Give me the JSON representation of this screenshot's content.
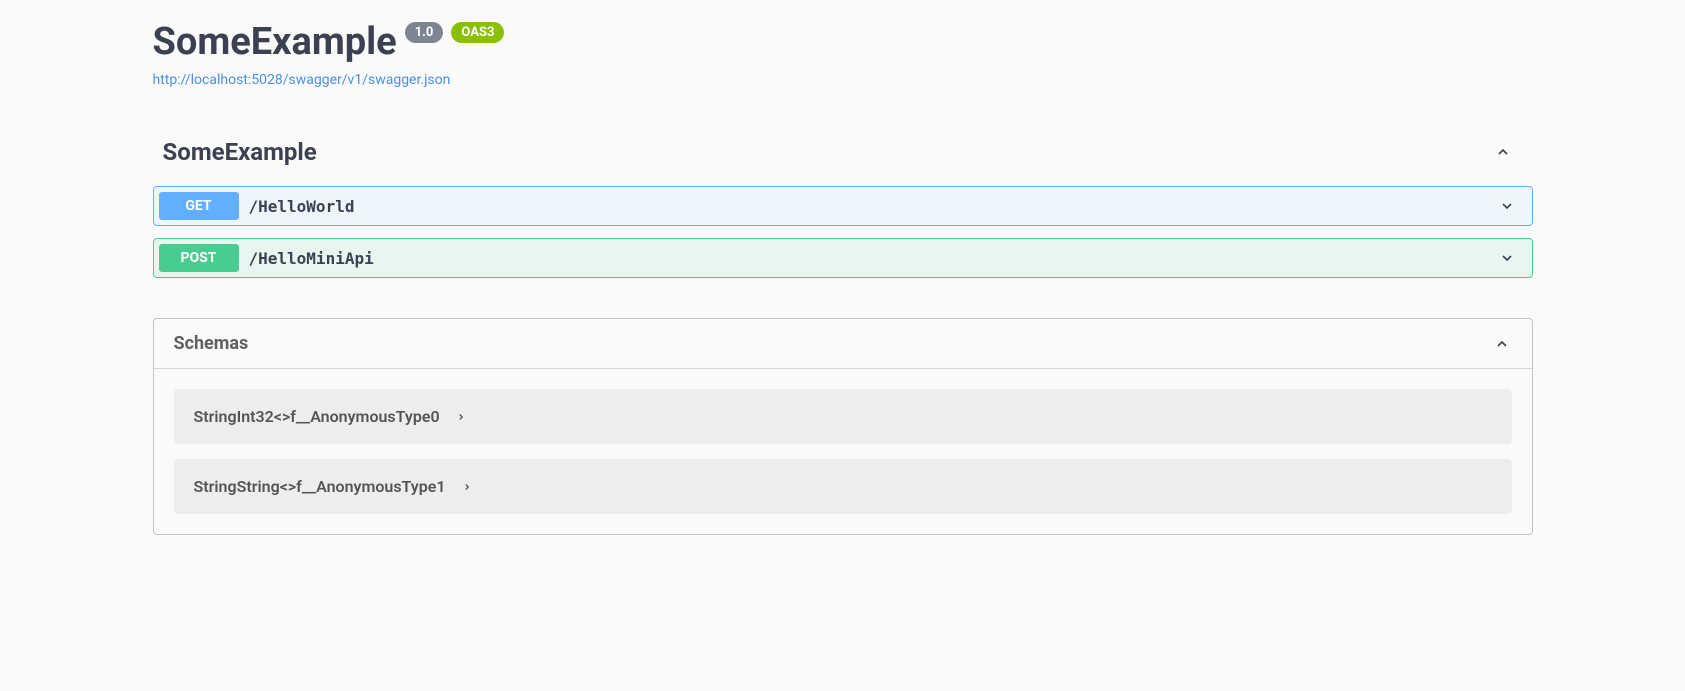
{
  "header": {
    "title": "SomeExample",
    "version": "1.0",
    "oas": "OAS3",
    "specUrl": "http://localhost:5028/swagger/v1/swagger.json"
  },
  "tag": {
    "name": "SomeExample",
    "operations": [
      {
        "method": "GET",
        "path": "/HelloWorld",
        "methodClass": "get"
      },
      {
        "method": "POST",
        "path": "/HelloMiniApi",
        "methodClass": "post"
      }
    ]
  },
  "schemas": {
    "title": "Schemas",
    "items": [
      {
        "name": "StringInt32<>f__AnonymousType0"
      },
      {
        "name": "StringString<>f__AnonymousType1"
      }
    ]
  }
}
